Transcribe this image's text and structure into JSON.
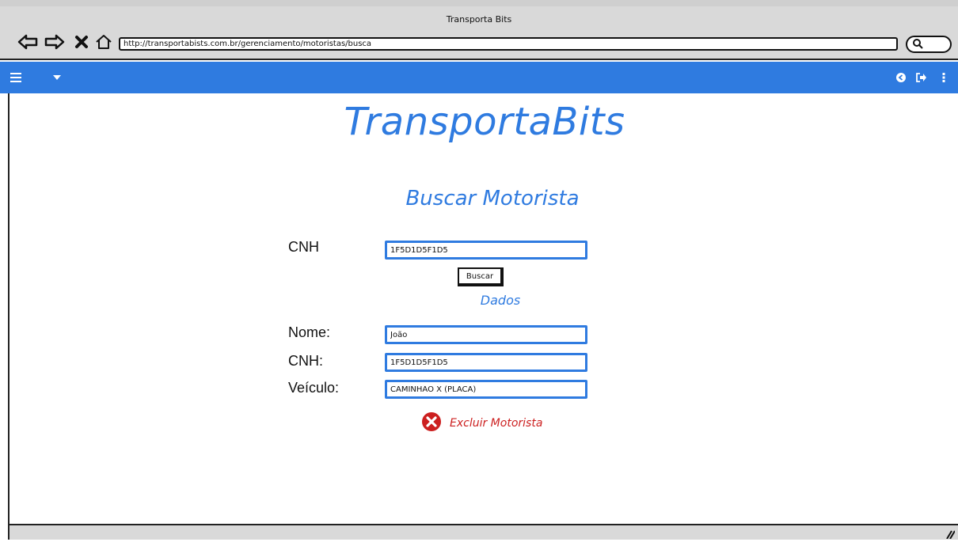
{
  "window": {
    "title": "Transporta Bits",
    "url": "http://transportabists.com.br/gerenciamento/motoristas/busca"
  },
  "toolbar": {
    "back_icon": "back-arrow-icon",
    "forward_icon": "forward-arrow-icon",
    "stop_icon": "close-icon",
    "home_icon": "home-icon",
    "search_icon": "search-icon"
  },
  "appbar": {
    "color": "#2f7be0",
    "left_icons": [
      "menu-icon",
      "caret-down-icon"
    ],
    "right_icons": [
      "refresh-icon",
      "logout-icon",
      "more-vertical-icon"
    ]
  },
  "main": {
    "brand": "TransportaBits",
    "section_title": "Buscar Motorista",
    "search": {
      "label": "CNH",
      "value": "1F5D1D5F1D5",
      "button_label": "Buscar"
    },
    "data_title": "Dados",
    "fields": [
      {
        "label": "Nome:",
        "value": "João"
      },
      {
        "label": "CNH:",
        "value": "1F5D1D5F1D5"
      },
      {
        "label": "Veículo:",
        "value": "CAMINHÃO X (PLACA)"
      }
    ],
    "delete_label": "Excluir Motorista",
    "delete_icon": "delete-circle-icon",
    "delete_color": "#cc1f1f"
  }
}
